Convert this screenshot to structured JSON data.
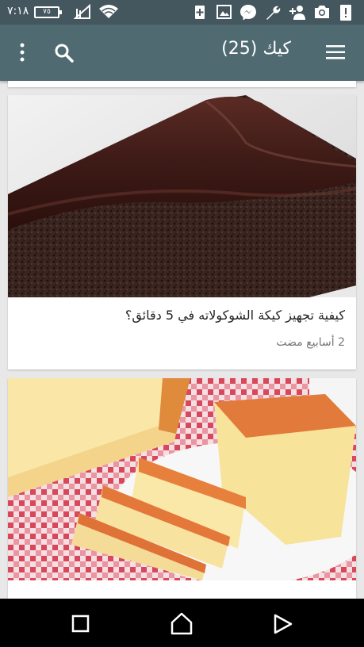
{
  "status_bar": {
    "time": "٧:١٨",
    "battery_level": "٧٥",
    "icons": [
      "battery-icon",
      "signal-icon",
      "wifi-icon",
      "add-icon",
      "image-icon",
      "messenger-icon",
      "wrench-icon",
      "person-add-icon",
      "camera-icon",
      "alert-icon"
    ]
  },
  "app_bar": {
    "title": "كيك (25)",
    "icons": [
      "menu-icon",
      "search-icon",
      "more-vert-icon"
    ]
  },
  "cards": [
    {
      "title": "كيفية تجهيز كيكة الشوكولاته في 5 دقائق؟",
      "meta": "2 أسابيع مضت",
      "image": "chocolate-cake-slice"
    },
    {
      "title": "",
      "image": "sponge-cake-slices"
    }
  ],
  "nav_bar": {
    "icons": [
      "recents-icon",
      "home-icon",
      "back-icon"
    ]
  },
  "colors": {
    "app_bar": "#506a72",
    "status_bar": "#44565e",
    "background": "#e8e8e8"
  }
}
